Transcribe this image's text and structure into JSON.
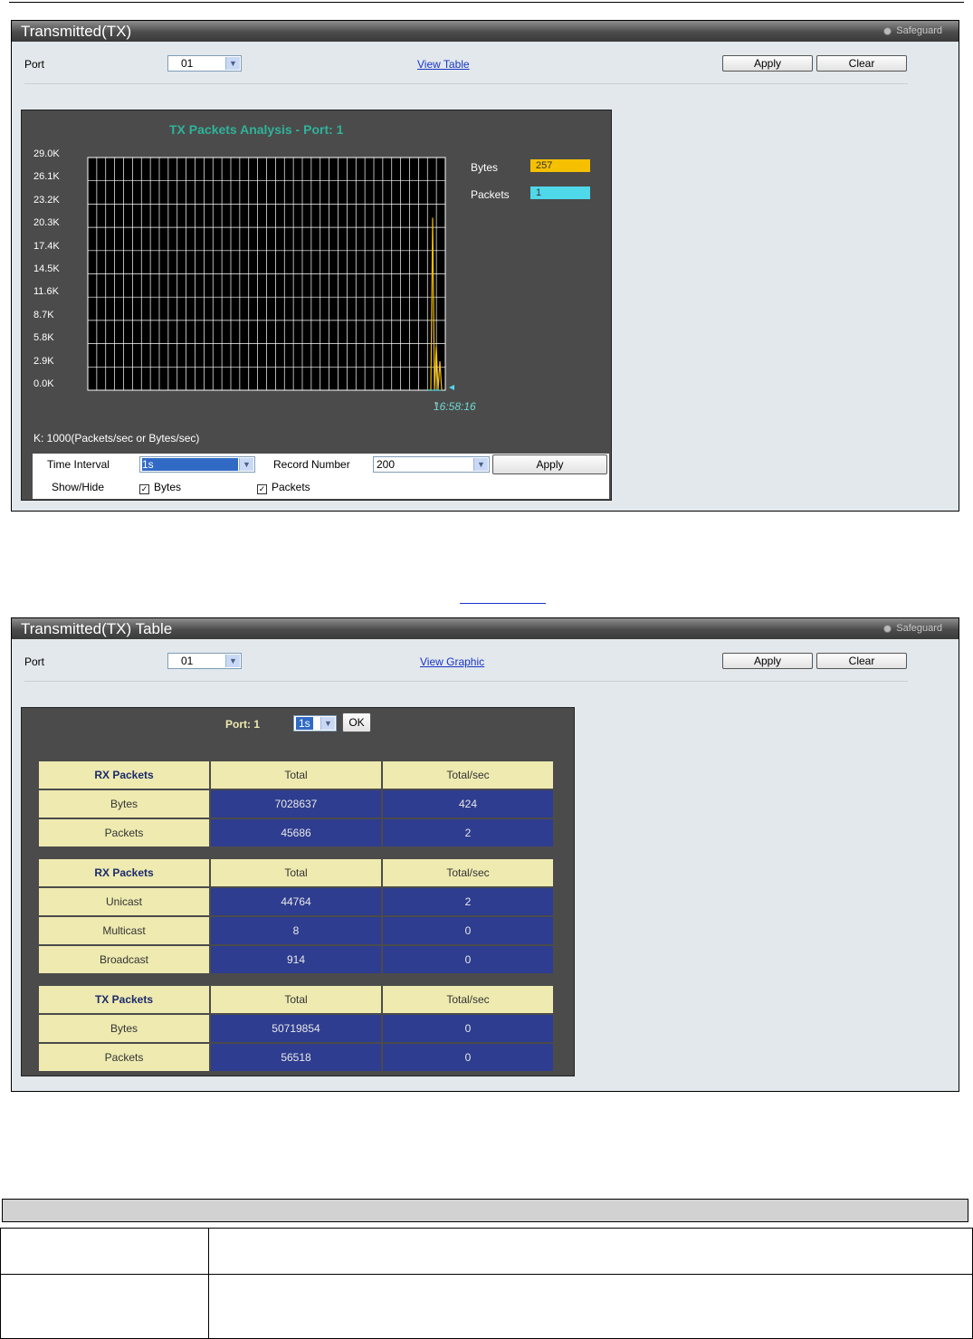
{
  "graphic_panel": {
    "title": "Transmitted(TX)",
    "safeguard": "Safeguard",
    "port_label": "Port",
    "port_value": "01",
    "view_link": "View Table",
    "apply": "Apply",
    "clear": "Clear"
  },
  "chart": {
    "title": "TX Packets Analysis - Port: 1",
    "time_label": "16:58:16",
    "unit_note": "K: 1000(Packets/sec or Bytes/sec)",
    "legend": [
      {
        "name": "Bytes",
        "value": "257",
        "color": "#f5c000"
      },
      {
        "name": "Packets",
        "value": "1",
        "color": "#4fd8ea"
      }
    ],
    "controls": {
      "time_interval_label": "Time Interval",
      "time_interval_value": "1s",
      "record_number_label": "Record Number",
      "record_number_value": "200",
      "apply": "Apply",
      "showhide_label": "Show/Hide",
      "bytes_check": "Bytes",
      "packets_check": "Packets"
    }
  },
  "chart_data": {
    "type": "line",
    "title": "TX Packets Analysis - Port: 1",
    "ylim": [
      0,
      29000
    ],
    "y_ticks": [
      "29.0K",
      "26.1K",
      "23.2K",
      "20.3K",
      "17.4K",
      "14.5K",
      "11.6K",
      "8.7K",
      "5.8K",
      "2.9K",
      "0.0K"
    ],
    "x_last_label": "16:58:16",
    "grid": true,
    "legend_position": "right",
    "series": [
      {
        "name": "Bytes",
        "color": "#f5c000",
        "values": [
          0,
          0,
          0,
          21500,
          0,
          5500,
          0,
          3600,
          0
        ]
      },
      {
        "name": "Packets",
        "color": "#4fd8ea",
        "values": [
          0,
          0,
          0,
          0,
          0,
          0,
          0,
          0,
          0
        ]
      }
    ]
  },
  "table_panel": {
    "title": "Transmitted(TX) Table",
    "safeguard": "Safeguard",
    "port_label": "Port",
    "port_value": "01",
    "view_link": "View Graphic",
    "apply": "Apply",
    "clear": "Clear",
    "port_caption": "Port: 1",
    "interval_value": "1s",
    "ok": "OK",
    "tables": [
      {
        "header": [
          "RX Packets",
          "Total",
          "Total/sec"
        ],
        "rows": [
          [
            "Bytes",
            "7028637",
            "424"
          ],
          [
            "Packets",
            "45686",
            "2"
          ]
        ]
      },
      {
        "header": [
          "RX Packets",
          "Total",
          "Total/sec"
        ],
        "rows": [
          [
            "Unicast",
            "44764",
            "2"
          ],
          [
            "Multicast",
            "8",
            "0"
          ],
          [
            "Broadcast",
            "914",
            "0"
          ]
        ]
      },
      {
        "header": [
          "TX Packets",
          "Total",
          "Total/sec"
        ],
        "rows": [
          [
            "Bytes",
            "50719854",
            "0"
          ],
          [
            "Packets",
            "56518",
            "0"
          ]
        ]
      }
    ]
  },
  "colors": {
    "bytes": "#f5c000",
    "packets": "#4fd8ea",
    "chart_bg": "#4b4b4b",
    "table_value_bg": "#2e3d8f",
    "table_label_bg": "#eeeab0"
  }
}
